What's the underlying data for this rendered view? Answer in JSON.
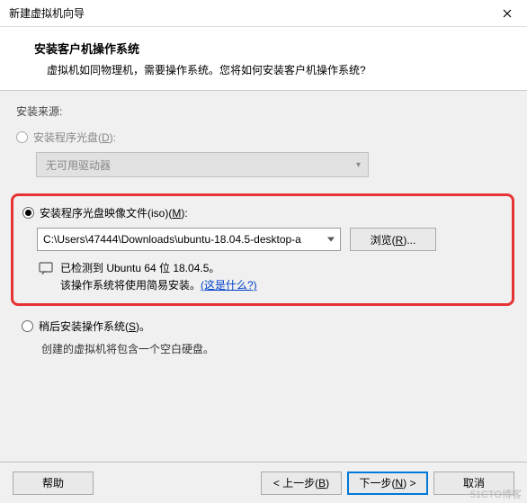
{
  "titlebar": {
    "title": "新建虚拟机向导"
  },
  "header": {
    "title": "安装客户机操作系统",
    "desc": "虚拟机如同物理机，需要操作系统。您将如何安装客户机操作系统?"
  },
  "source": {
    "label": "安装来源:",
    "disc": {
      "label_pre": "安装程序光盘(",
      "mnemonic": "D",
      "label_post": "):",
      "combo": "无可用驱动器"
    },
    "iso": {
      "label_pre": "安装程序光盘映像文件(iso)(",
      "mnemonic": "M",
      "label_post": "):",
      "path": "C:\\Users\\47444\\Downloads\\ubuntu-18.04.5-desktop-a",
      "browse_pre": "浏览(",
      "browse_mnemonic": "R",
      "browse_post": ")...",
      "detected_line1": "已检测到 Ubuntu 64 位 18.04.5。",
      "detected_line2_pre": "该操作系统将使用简易安装。",
      "detected_link": "(这是什么?)"
    },
    "later": {
      "label_pre": "稍后安装操作系统(",
      "mnemonic": "S",
      "label_post": ")。",
      "desc": "创建的虚拟机将包含一个空白硬盘。"
    }
  },
  "footer": {
    "help": "帮助",
    "back_pre": "< 上一步(",
    "back_mnemonic": "B",
    "back_post": ")",
    "next_pre": "下一步(",
    "next_mnemonic": "N",
    "next_post": ") >",
    "cancel": "取消"
  },
  "watermark": "51CTO博客"
}
